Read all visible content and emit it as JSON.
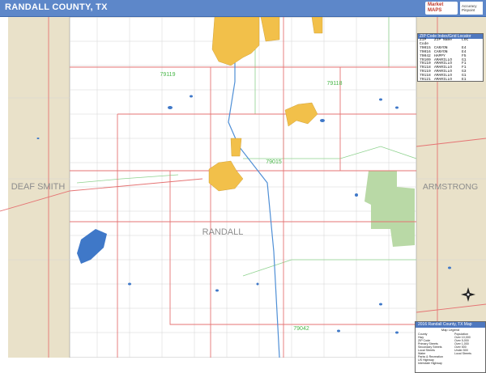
{
  "title": "RANDALL COUNTY, TX",
  "logo": {
    "brand": "Market MAPS",
    "side_text": "Accuracy Pinpoint"
  },
  "map": {
    "county_label": "RANDALL",
    "neighbor_west": "DEAF SMITH",
    "neighbor_east": "ARMSTRONG",
    "zip_labels": [
      "79119",
      "79118",
      "79015",
      "79042"
    ],
    "colors": {
      "city": "#f2c04a",
      "park": "#b9d9a6",
      "neighbor": "#e9e1c9",
      "highway": "#e57373",
      "water": "#3f78c8",
      "zip_line": "#8fd28f",
      "interstate": "#4f8fd6"
    }
  },
  "zip_table": {
    "title": "ZIP Code Index/Grid Locator",
    "headers": [
      "ZIP Code",
      "ZIP Name",
      "LOC"
    ],
    "rows": [
      [
        "79015",
        "CANYON",
        "E4"
      ],
      [
        "79016",
        "CANYON",
        "E4"
      ],
      [
        "79042",
        "HAPPY",
        "F5"
      ],
      [
        "79109",
        "AMARILLO",
        "G1"
      ],
      [
        "79110",
        "AMARILLO",
        "F1"
      ],
      [
        "79118",
        "AMARILLO",
        "F1"
      ],
      [
        "79119",
        "AMARILLO",
        "G3"
      ],
      [
        "79118",
        "AMARILLO",
        "G1"
      ],
      [
        "79121",
        "AMARILLO",
        "E1"
      ]
    ]
  },
  "legend": {
    "title": "2016 Randall County, TX Map",
    "subtitle": "Map Legend",
    "left_items": [
      "County",
      "Hwy",
      "ZIP Code",
      "Primary Streets",
      "Secondary Streets",
      "Local Streets",
      "Water",
      "Parks & Recreation",
      "US Highway",
      "Interstate Highway"
    ],
    "right_items": [
      "Population",
      "Over 10,000",
      "Over 5,000",
      "Over 1,000",
      "Over 500",
      "Under 500",
      "Local Streets"
    ]
  }
}
